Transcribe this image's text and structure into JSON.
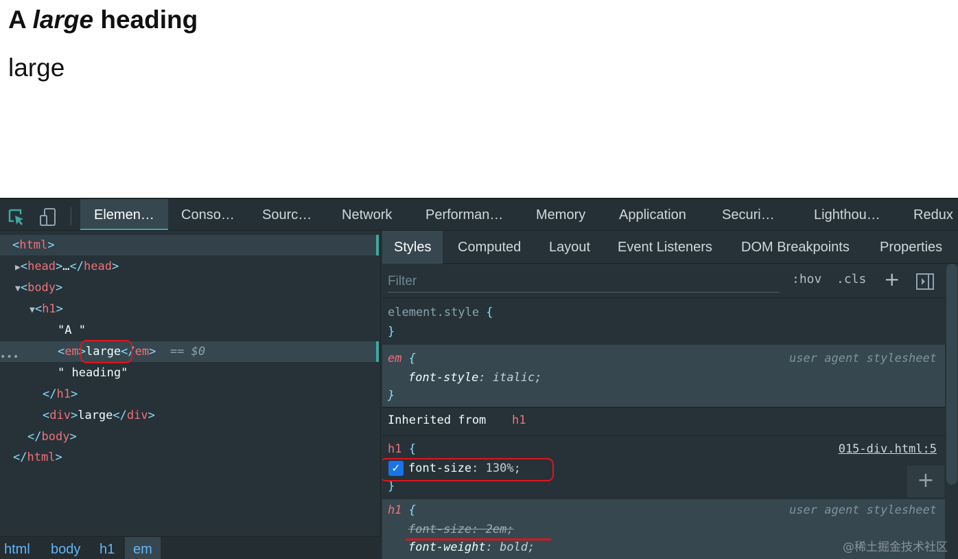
{
  "page": {
    "heading_pre": "A ",
    "heading_em": "large",
    "heading_post": " heading",
    "div_text": "large"
  },
  "devtools": {
    "tabs": [
      "Elemen…",
      "Conso…",
      "Sourc…",
      "Network",
      "Performan…",
      "Memory",
      "Application",
      "Securi…",
      "Lighthou…",
      "Redux"
    ],
    "active_tab": "Elemen…",
    "icons": {
      "inspect": "inspect-icon",
      "device": "device-toggle-icon"
    },
    "accent_color": "#3fa8a1",
    "tag_color": "#f07178",
    "bracket_color": "#89ddff",
    "dom": {
      "html_open": "html",
      "head": "head",
      "head_ellipsis": "…",
      "body": "body",
      "h1": "h1",
      "text_a": "\"A \"",
      "em": "em",
      "em_text": "large",
      "dollar": "== $0",
      "text_heading": "\" heading\"",
      "div": "div",
      "div_text": "large",
      "dots": "•••"
    },
    "breadcrumbs": [
      "html",
      "body",
      "h1",
      "em"
    ],
    "subtabs": [
      "Styles",
      "Computed",
      "Layout",
      "Event Listeners",
      "DOM Breakpoints",
      "Properties"
    ],
    "filter_placeholder": "Filter",
    "filter_buttons": [
      ":hov",
      ".cls",
      "+"
    ],
    "rules": {
      "element_style": "element.style",
      "em_selector": "em",
      "em_origin": "user agent stylesheet",
      "em_prop": "font-style",
      "em_val": "italic",
      "inherited_label": "Inherited from",
      "inherited_tag": "h1",
      "h1_author_selector": "h1",
      "h1_author_origin": "015-div.html:5",
      "h1_author_prop": "font-size",
      "h1_author_val": "130%",
      "h1_ua_selector": "h1",
      "h1_ua_origin": "user agent stylesheet",
      "h1_ua_prop1": "font-size",
      "h1_ua_val1": "2em",
      "h1_ua_prop2": "font-weight",
      "h1_ua_val2": "bold"
    },
    "add_rule": "+",
    "checkmark": "✓"
  },
  "watermark": "@稀土掘金技术社区"
}
